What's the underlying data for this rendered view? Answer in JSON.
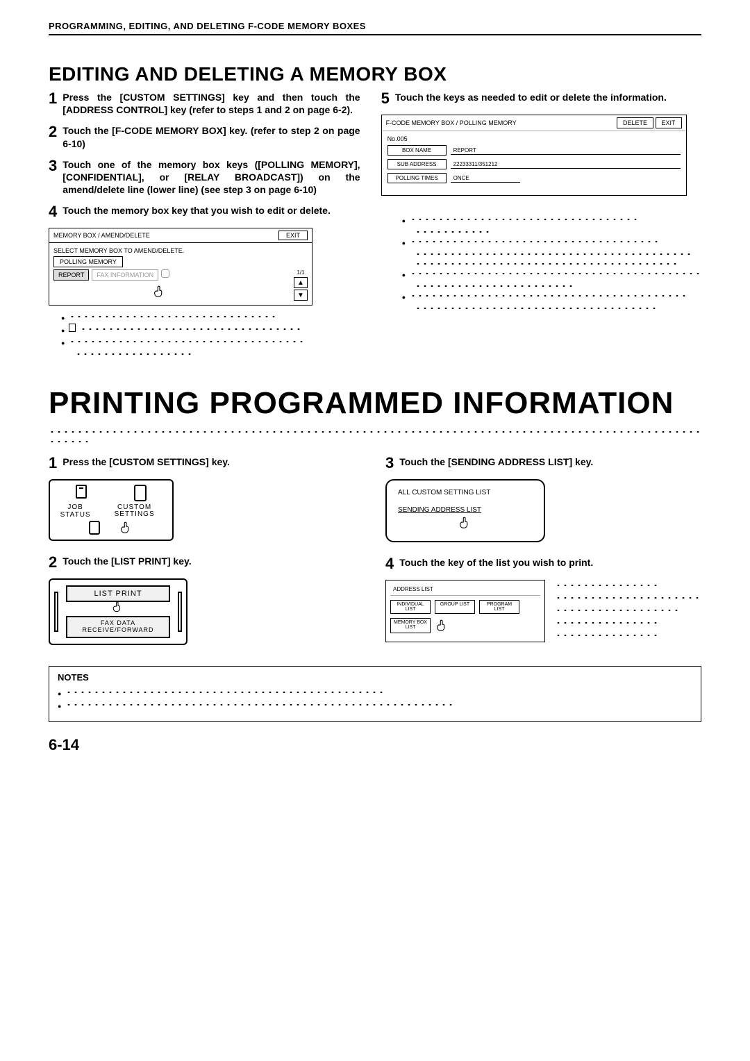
{
  "header": "PROGRAMMING, EDITING, AND DELETING F-CODE MEMORY BOXES",
  "section1_title": "EDITING AND DELETING A MEMORY BOX",
  "steps_left": {
    "s1": "Press the [CUSTOM SETTINGS] key and then touch the [ADDRESS CONTROL] key (refer to steps 1 and 2 on page 6-2).",
    "s2": "Touch the [F-CODE MEMORY BOX] key. (refer to step 2 on page 6-10)",
    "s3": "Touch one of the memory box keys ([POLLING MEMORY], [CONFIDENTIAL], or [RELAY BROADCAST]) on the amend/delete line (lower line) (see step 3 on page 6-10)",
    "s4": "Touch the memory box key that you wish to edit or delete."
  },
  "steps_right": {
    "s5": "Touch the keys as needed to edit or delete the information."
  },
  "fig4": {
    "title": "MEMORY BOX / AMEND/DELETE",
    "exit": "EXIT",
    "subtitle": "SELECT MEMORY BOX TO AMEND/DELETE.",
    "tab": "POLLING MEMORY",
    "btn1": "REPORT",
    "btn2": "FAX INFORMATION",
    "page": "1/1"
  },
  "fig5": {
    "hdr": "F-CODE MEMORY BOX / POLLING MEMORY",
    "delete": "DELETE",
    "exit": "EXIT",
    "no": "No.005",
    "boxname_label": "BOX NAME",
    "boxname_val": "REPORT",
    "subaddr_label": "SUB ADDRESS",
    "subaddr_val": "22233311/351212",
    "poll_label": "POLLING TIMES",
    "poll_val": "ONCE"
  },
  "section2_title": "PRINTING PROGRAMMED INFORMATION",
  "p_steps": {
    "s1": "Press the [CUSTOM SETTINGS] key.",
    "s2": "Touch the [LIST PRINT] key.",
    "s3": "Touch the [SENDING ADDRESS LIST] key.",
    "s4": "Touch the key of the list you wish to print."
  },
  "custom_panel": {
    "left": "JOB STATUS",
    "right": "CUSTOM SETTINGS"
  },
  "list_panel": {
    "k1": "LIST PRINT",
    "k2": "FAX DATA RECEIVE/FORWARD"
  },
  "round_fig": {
    "t1": "ALL CUSTOM SETTING LIST",
    "t2": "SENDING ADDRESS LIST"
  },
  "addr_fig": {
    "top": "ADDRESS LIST",
    "k1": "INDIVIDUAL LIST",
    "k2": "GROUP LIST",
    "k3": "PROGRAM LIST",
    "k4": "MEMORY BOX LIST"
  },
  "notes_title": "NOTES",
  "page_num": "6-14"
}
